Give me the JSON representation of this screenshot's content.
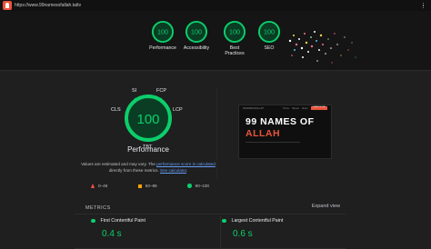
{
  "topbar": {
    "url": "https://www.99namesofallah.tattv"
  },
  "header": {
    "scores": [
      {
        "value": "100",
        "label": "Performance"
      },
      {
        "value": "100",
        "label": "Accessibility"
      },
      {
        "value": "100",
        "label": "Best Practices"
      },
      {
        "value": "100",
        "label": "SEO"
      }
    ]
  },
  "performance": {
    "score": "100",
    "title": "Performance",
    "metric_labels": {
      "si": "SI",
      "fcp": "FCP",
      "cls": "CLS",
      "lcp": "LCP",
      "tbt": "TBT"
    },
    "note_prefix": "Values are estimated and may vary. The ",
    "note_link1": "performance score is calculated",
    "note_middle": " directly from these metrics. ",
    "note_link2": "See calculator",
    "note_suffix": "."
  },
  "legend": [
    {
      "range": "0–49",
      "color": "#ff4e42"
    },
    {
      "range": "50–89",
      "color": "#ffa400"
    },
    {
      "range": "90–100",
      "color": "#0cce6b"
    }
  ],
  "screenshot": {
    "nav_brand": "99NAMESOFALLAH",
    "nav_links": [
      "Home",
      "Names",
      "About"
    ],
    "nav_button": "LEARN MORE",
    "title_line1": "99 NAMES OF",
    "title_line2": "ALLAH"
  },
  "metrics": {
    "heading": "METRICS",
    "expand": "Expand view",
    "items": [
      {
        "name": "First Contentful Paint",
        "value": "0.4 s"
      },
      {
        "name": "Largest Contentful Paint",
        "value": "0.6 s"
      }
    ]
  },
  "colors": {
    "good": "#0cce6b",
    "brand": "#e8543b",
    "link": "#669df6"
  }
}
